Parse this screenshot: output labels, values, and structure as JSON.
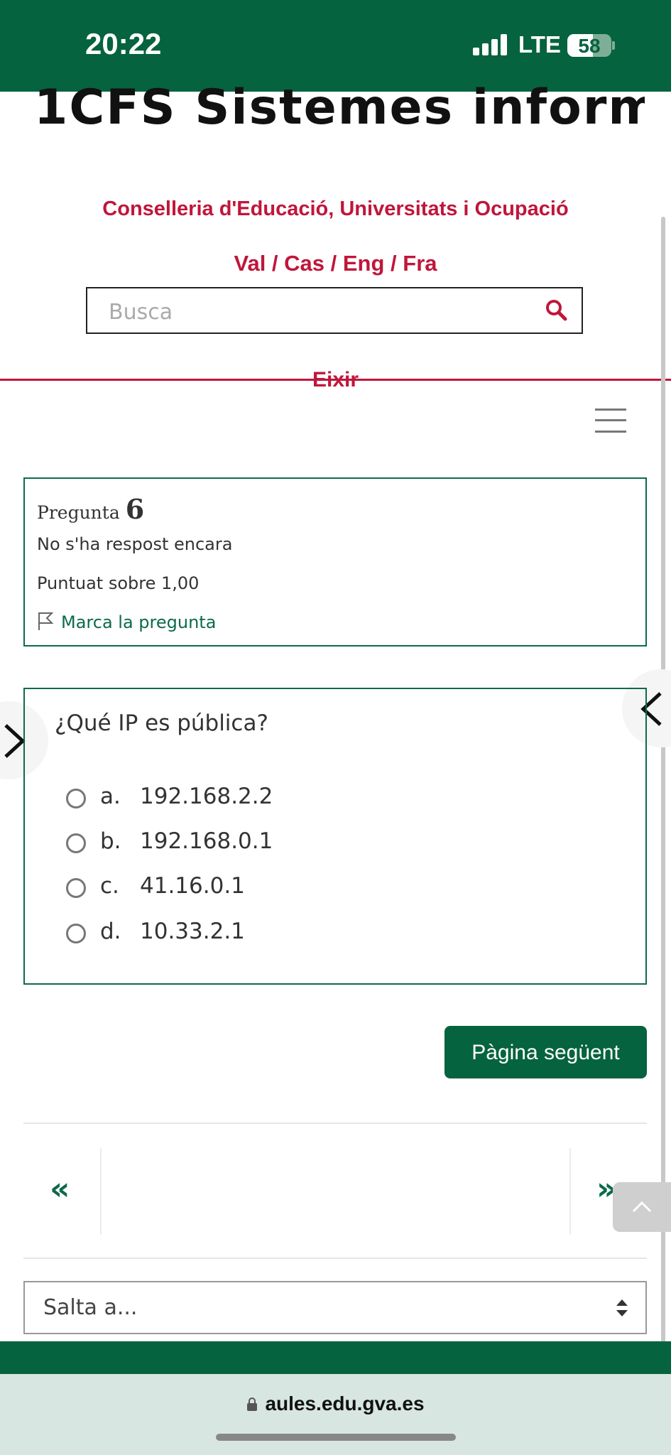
{
  "status_bar": {
    "time": "20:22",
    "network": "LTE",
    "battery": "58",
    "battery_level": 0.58
  },
  "header": {
    "site_title": "1CFS Sistemes inform ...",
    "org": "Conselleria d'Educació, Universitats i Ocupació",
    "langs": "Val / Cas / Eng / Fra",
    "search": {
      "placeholder": "Busca"
    },
    "exit": "Eixir"
  },
  "question_info": {
    "label": "Pregunta",
    "number": "6",
    "state": "No s'ha respost encara",
    "grade": "Puntuat sobre 1,00",
    "flag_label": "Marca la pregunta"
  },
  "question": {
    "text": "¿Qué IP es pública?",
    "options": [
      {
        "letter": "a.",
        "text": "192.168.2.2"
      },
      {
        "letter": "b.",
        "text": "192.168.0.1"
      },
      {
        "letter": "c.",
        "text": "41.16.0.1"
      },
      {
        "letter": "d.",
        "text": "10.33.2.1"
      }
    ]
  },
  "next_page_label": "Pàgina següent",
  "pager": {
    "prev": "«",
    "next": "»"
  },
  "jump": {
    "label": "Salta a..."
  },
  "browser": {
    "url": "aules.edu.gva.es"
  },
  "colors": {
    "brand_green": "#05633f",
    "accent_red": "#c0163b"
  }
}
